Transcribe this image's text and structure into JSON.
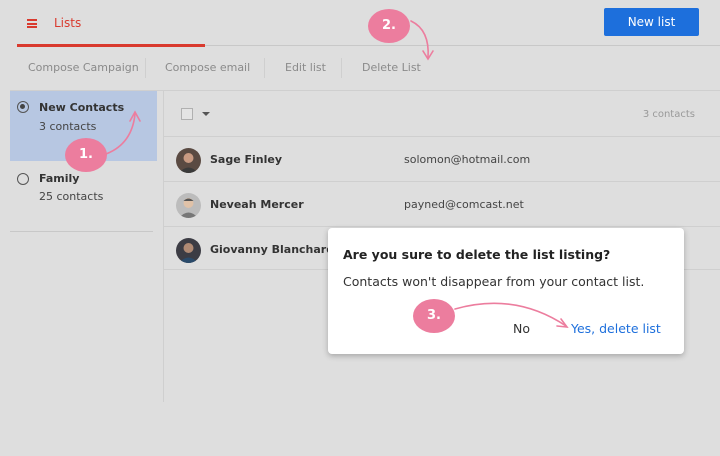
{
  "header": {
    "tab_label": "Lists",
    "tab_icon": "list-icon",
    "new_list_label": "New list",
    "accent_color": "#d93a2e",
    "primary_color": "#1d6fdc"
  },
  "toolbar": {
    "compose_campaign": "Compose Campaign",
    "compose_email": "Compose email",
    "edit_list": "Edit list",
    "delete_list": "Delete List"
  },
  "sidebar": {
    "items": [
      {
        "name": "New Contacts",
        "count": "3 contacts",
        "selected": true
      },
      {
        "name": "Family",
        "count": "25 contacts",
        "selected": false
      }
    ]
  },
  "content": {
    "contact_count": "3 contacts",
    "contacts": [
      {
        "name": "Sage Finley",
        "email": "solomon@hotmail.com"
      },
      {
        "name": "Neveah Mercer",
        "email": "payned@comcast.net"
      },
      {
        "name": "Giovanny Blanchard",
        "email": ""
      }
    ]
  },
  "dialog": {
    "title": "Are you sure to delete the list listing?",
    "body": "Contacts won't disappear from your contact list.",
    "no_label": "No",
    "yes_label": "Yes, delete list"
  },
  "annotations": {
    "step1": "1.",
    "step2": "2.",
    "step3": "3.",
    "color": "#ec7d9e"
  }
}
